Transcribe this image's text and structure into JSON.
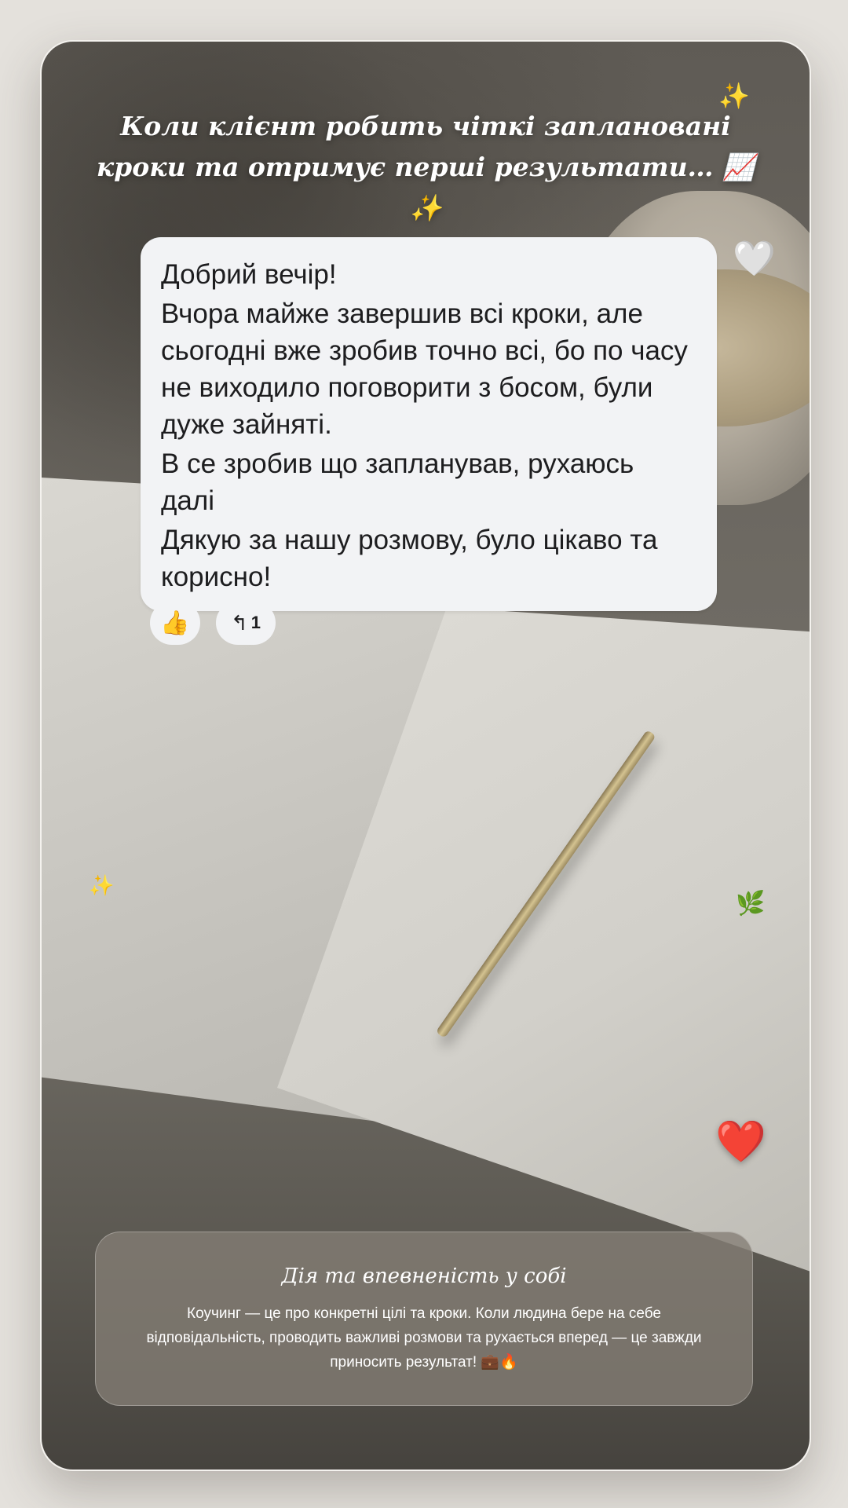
{
  "headline": "Коли клієнт робить чіткі заплановані кроки та отримує перші результати… 📈✨",
  "decorations": {
    "sparkle_icon": "✨",
    "white_heart_icon": "🤍",
    "red_heart_icon": "❤️",
    "leaf_icon": "🌿"
  },
  "message": {
    "lines": [
      "Добрий вечір!",
      "Вчора майже завершив всі кроки, але сьогодні вже зробив точно всі, бо по часу не виходило поговорити з босом, були дуже зайняті.",
      "В се зробив що запланував, рухаюсь далі",
      "Дякую за нашу розмову, було цікаво та корисно!"
    ],
    "reaction_emoji": "👍",
    "reply_arrow": "↰",
    "reply_count": "1"
  },
  "info": {
    "title": "Дія та впевненість у собі",
    "text": "Коучинг — це про конкретні цілі та кроки. Коли людина бере на себе відповідальність, проводить важливі розмови та рухається вперед — це завжди приносить результат! 💼🔥"
  },
  "colors": {
    "bubble_bg": "#f2f3f5",
    "headline_text": "#ffffff",
    "heart_red": "#e3262b",
    "sparkle_gold": "#f3d06a"
  }
}
